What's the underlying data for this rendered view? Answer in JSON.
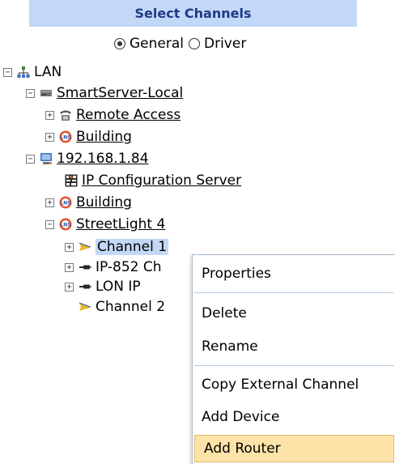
{
  "panel": {
    "title": "Select Channels"
  },
  "mode": {
    "options": [
      "General",
      "Driver"
    ],
    "selected": "General"
  },
  "tree": {
    "lan": "LAN",
    "smartserver_local": "SmartServer-Local",
    "remote_access": "Remote Access",
    "building_1": "Building",
    "ip_address": "192.168.1.84",
    "ip_config_server": "IP Configuration Server",
    "building_2": "Building",
    "streetlight": "StreetLight 4",
    "channel_1": "Channel 1",
    "ip852": "IP-852 Ch",
    "lon_ip": "LON IP",
    "channel_2": "Channel 2"
  },
  "context_menu": {
    "items": [
      "Properties",
      "Delete",
      "Rename",
      "Copy External Channel",
      "Add Device",
      "Add Router"
    ],
    "highlighted": "Add Router"
  },
  "colors": {
    "panel_header": "#c2d8f6",
    "title_text": "#1f3a86",
    "menu_highlight": "#fde3a8"
  }
}
